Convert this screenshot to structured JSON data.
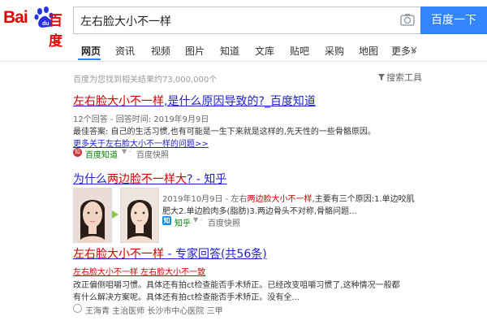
{
  "logo": {
    "bai": "Bai",
    "du": "du",
    "baidu": "百度"
  },
  "search": {
    "query": "左右脸大小不一样",
    "button": "百度一下"
  },
  "tabs": [
    "网页",
    "资讯",
    "视频",
    "图片",
    "知道",
    "文库",
    "贴吧",
    "采购",
    "地图",
    "更多»"
  ],
  "results_count": "百度为您找到相关结果约73,000,000个",
  "tools": "搜索工具",
  "results": [
    {
      "title_em": "左右脸大小不一样",
      "title_rest": ",是什么原因导致的?_百度知道",
      "meta": "12个回答 - 回答时间: 2019年9月9日",
      "snippet": "最佳答案: 自己的生活习惯,也有可能是一生下来就是这样的,先天性的一些骨骼原因。",
      "more": "更多关于左右脸大小不一样的问题>>",
      "source": "百度知道",
      "snapshot": "百度快照"
    },
    {
      "title_pre": "为什么",
      "title_em": "两边脸不一样大",
      "title_rest": "? - 知乎",
      "date": "2019年10月9日 - 左右",
      "date_em": "两边脸大小不一样",
      "snippet1_rest": ",主要有三个原因:1.单边咬肌",
      "snippet2": "肥大2.单边脸肉多(脂肪)3.两边骨头不对称,骨骼问题...",
      "source": "知乎",
      "snapshot": "百度快照"
    },
    {
      "title_em": "左右脸大小不一样",
      "title_rest": " - 专家回答(共56条)",
      "sub_links": "左右脸大小不一样   左右脸大小不一致",
      "snippet1": "改正偏侧咀嚼习惯。具体还有拍ct检查能否手术矫正。已经改变咀嚼习惯了,这种情况一般都",
      "snippet2": "有什么解决方案呢。具体还有拍ct检查能否手术矫正。没有全...",
      "expert": "王海青  主治医师  长沙市中心医院  三甲"
    }
  ]
}
